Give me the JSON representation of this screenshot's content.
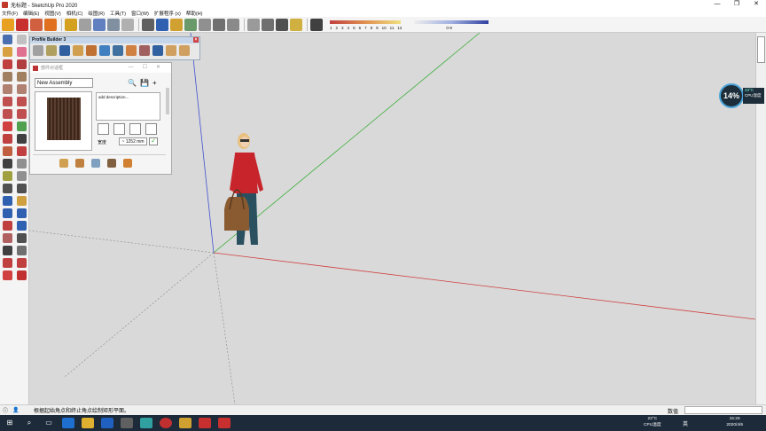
{
  "window": {
    "title": "无标题 - SketchUp Pro 2020",
    "controls": [
      "—",
      "❐",
      "✕"
    ]
  },
  "menu": [
    "文件(F)",
    "编辑(E)",
    "视图(V)",
    "相机(C)",
    "绘图(R)",
    "工具(T)",
    "窗口(W)",
    "扩展程序 (x)",
    "帮助(H)"
  ],
  "toolbar": {
    "scale_labels": [
      "1",
      "2",
      "3",
      "4",
      "5",
      "6",
      "7",
      "8",
      "9",
      "10",
      "11",
      "12"
    ],
    "scale_label_small": "0-9"
  },
  "profile_builder": {
    "title": "Profile Builder 3",
    "close": "×"
  },
  "component_panel": {
    "title": "部件对话框",
    "controls": "—☐✕",
    "assembly_name": "New Assembly",
    "search_icons": [
      "🔍",
      "💾",
      "+"
    ],
    "description": "add description...",
    "width_label": "宽度",
    "width_value": "~ 1252 mm",
    "ok_symbol": "✓"
  },
  "status": {
    "text": "根据起始角点和终止角点绘制矩形平面。",
    "measurement_label": "数值",
    "measurement_value": ""
  },
  "gauge": {
    "value": "14%",
    "temp": "23°C",
    "label": "CPU温度"
  },
  "taskbar": {
    "weather": "23°C",
    "weather_sub": "CPU温度",
    "lang": "英",
    "time": "15:26",
    "date": "2020/4/6"
  },
  "colors": {
    "axis_red": "#d04040",
    "axis_green": "#40b040",
    "axis_blue": "#4050d0",
    "sky_bg": "#d9d9d9"
  }
}
